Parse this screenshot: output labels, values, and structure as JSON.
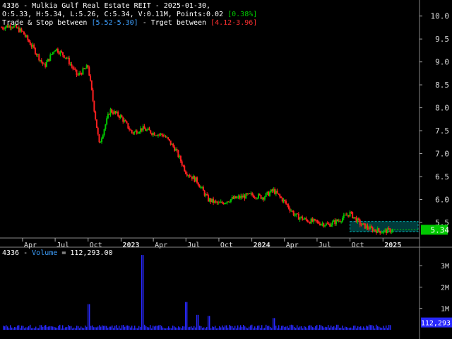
{
  "header": {
    "title": "4336 - Mulkia Gulf Real Estate REIT - 2025-01-30,",
    "ohlc": "O:5.33, H:5.34, L:5.26, C:5.34, V:0.11M, Points:0.02",
    "change": "[0.38%]",
    "trade_prefix": "Trade & Stop between",
    "trade_range": "[5.52-5.30]",
    "target_prefix": " - Trget between",
    "target_range": "[4.12-3.96]"
  },
  "volume_header": {
    "symbol": "4336 -",
    "label": "Volume",
    "value": "= 112,293.00"
  },
  "last_price_label": "5.34",
  "last_volume_label": "112,293",
  "colors": {
    "up": "#00c800",
    "down": "#ff2020",
    "volume": "#2828ff",
    "zone": "#00a8a8",
    "price_tag": "#00c800"
  },
  "chart_data": {
    "type": "candlestick",
    "price_axis": {
      "ylim": [
        5.16,
        10.35
      ],
      "ticks": [
        "10.0",
        "9.5",
        "9.0",
        "8.5",
        "8.0",
        "7.5",
        "7.0",
        "6.5",
        "6.0",
        "5.5"
      ]
    },
    "time_axis": {
      "range": [
        "2022-02",
        "2025-02"
      ],
      "ticks": [
        "Apr",
        "Jul",
        "Oct",
        "2023",
        "Apr",
        "Jul",
        "Oct",
        "2024",
        "Apr",
        "Jul",
        "Oct",
        "2025"
      ]
    },
    "volume_axis": {
      "ylim": [
        0,
        3800000
      ],
      "ticks": [
        "3M",
        "2M",
        "1M"
      ]
    },
    "trade_zone": {
      "low": 5.3,
      "high": 5.52,
      "start": "2024-10",
      "end": "2025-02"
    },
    "close_path": [
      [
        "2022-02",
        9.75
      ],
      [
        "2022-03",
        9.8
      ],
      [
        "2022-04",
        9.65
      ],
      [
        "2022-05",
        9.3
      ],
      [
        "2022-06",
        8.9
      ],
      [
        "2022-07",
        9.3
      ],
      [
        "2022-08",
        9.1
      ],
      [
        "2022-09",
        8.7
      ],
      [
        "2022-10",
        8.9
      ],
      [
        "2022-11",
        7.2
      ],
      [
        "2022-12",
        7.95
      ],
      [
        "2023-01",
        7.8
      ],
      [
        "2023-02",
        7.45
      ],
      [
        "2023-03",
        7.55
      ],
      [
        "2023-04",
        7.45
      ],
      [
        "2023-05",
        7.4
      ],
      [
        "2023-06",
        7.1
      ],
      [
        "2023-07",
        6.6
      ],
      [
        "2023-08",
        6.4
      ],
      [
        "2023-09",
        6.0
      ],
      [
        "2023-10",
        5.9
      ],
      [
        "2023-11",
        6.0
      ],
      [
        "2023-12",
        6.05
      ],
      [
        "2024-01",
        6.1
      ],
      [
        "2024-02",
        6.05
      ],
      [
        "2024-03",
        6.2
      ],
      [
        "2024-04",
        5.95
      ],
      [
        "2024-05",
        5.65
      ],
      [
        "2024-06",
        5.55
      ],
      [
        "2024-07",
        5.5
      ],
      [
        "2024-08",
        5.45
      ],
      [
        "2024-09",
        5.55
      ],
      [
        "2024-10",
        5.7
      ],
      [
        "2024-11",
        5.45
      ],
      [
        "2024-12",
        5.35
      ],
      [
        "2025-01",
        5.3
      ],
      [
        "2025-01-30",
        5.34
      ]
    ],
    "volume_spikes": [
      [
        "2023-03",
        3500000
      ],
      [
        "2023-07",
        1300000
      ],
      [
        "2022-10",
        1200000
      ],
      [
        "2023-08",
        700000
      ],
      [
        "2023-09",
        650000
      ],
      [
        "2024-03",
        550000
      ]
    ]
  }
}
